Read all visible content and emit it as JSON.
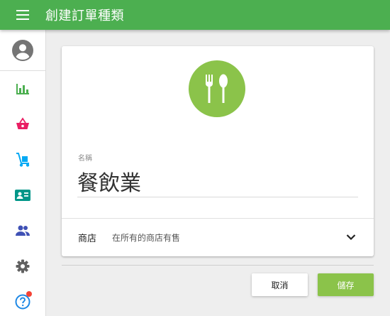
{
  "appbar": {
    "title": "創建訂單種類",
    "menu_icon": "menu-icon",
    "color": "#4caf50"
  },
  "sidebar": {
    "avatar_icon": "account-circle-icon",
    "items": [
      {
        "icon": "bar-chart-icon",
        "color": "#4caf50"
      },
      {
        "icon": "shopping-basket-icon",
        "color": "#e91e63"
      },
      {
        "icon": "hand-truck-icon",
        "color": "#03a9f4"
      },
      {
        "icon": "contact-card-icon",
        "color": "#009688"
      },
      {
        "icon": "people-icon",
        "color": "#3f51b5"
      },
      {
        "icon": "settings-icon",
        "color": "#616161"
      },
      {
        "icon": "help-icon",
        "color": "#1e88e5",
        "badge": true
      }
    ]
  },
  "form": {
    "category_icon": "restaurant-icon",
    "icon_bg": "#8bc34a",
    "name_label": "名稱",
    "name_value": "餐飲業",
    "store_label": "商店",
    "store_value": "在所有的商店有售"
  },
  "actions": {
    "cancel_label": "取消",
    "save_label": "儲存"
  }
}
